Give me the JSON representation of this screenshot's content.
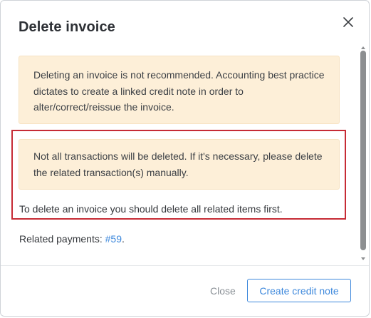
{
  "dialog": {
    "title": "Delete invoice",
    "close_icon": "close-icon"
  },
  "alerts": [
    {
      "text": "Deleting an invoice is not recommended. Accounting best practice dictates to create a linked credit note in order to alter/correct/reissue the invoice."
    },
    {
      "text": "Not all transactions will be deleted. If it's necessary, please delete the related transaction(s) manually."
    }
  ],
  "info_text": "To delete an invoice you should delete all related items first.",
  "related_payments": {
    "label": "Related payments:",
    "link": "#59",
    "suffix": "."
  },
  "footer": {
    "close_label": "Close",
    "credit_note_label": "Create credit note"
  },
  "colors": {
    "alert_bg": "#fdefd8",
    "highlight": "#c62b35",
    "link": "#3d88dc",
    "scrollbar_thumb": "#8d8f91"
  }
}
